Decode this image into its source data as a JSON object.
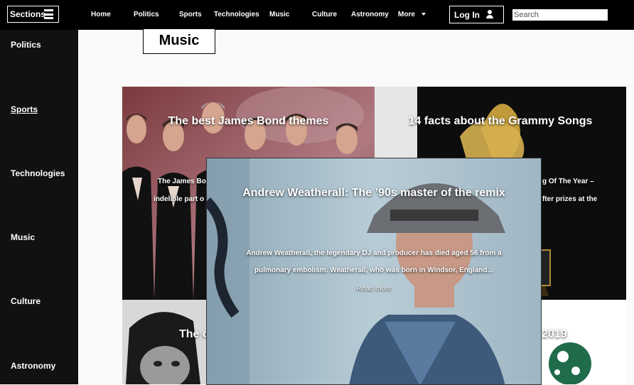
{
  "header": {
    "sections_label": "Sections",
    "nav": [
      "Home",
      "Politics",
      "Sports",
      "Technologies",
      "Music",
      "Culture",
      "Astronomy",
      "More"
    ],
    "login_label": "Log In",
    "search_placeholder": "Search"
  },
  "sidebar": {
    "items": [
      "Politics",
      "Sports",
      "Technologies",
      "Music",
      "Culture",
      "Astronomy"
    ],
    "active": "Sports"
  },
  "page": {
    "title": "Music"
  },
  "cards": [
    {
      "title": "The best James Bond themes",
      "line1": "The James Bo",
      "line2": "indelible part o"
    },
    {
      "title": "14 facts about the Grammy Songs",
      "line1": "g Of The Year –",
      "line2": "fter prizes at the"
    },
    {
      "title": "The o"
    },
    {
      "title": "2019"
    }
  ],
  "overlay": {
    "title": "Andrew Weatherall: The ’90s master of the remix",
    "line1": "Andrew Weatherall, the legendary DJ and producer has died aged 56 from a",
    "line2": "pulmonary embolism. Weatherall, who was born in Windsor, England...",
    "read_more": "Read more"
  },
  "colors": {
    "topbar": "#000000",
    "sidebar": "#111111",
    "page_bg": "#fafafa"
  }
}
